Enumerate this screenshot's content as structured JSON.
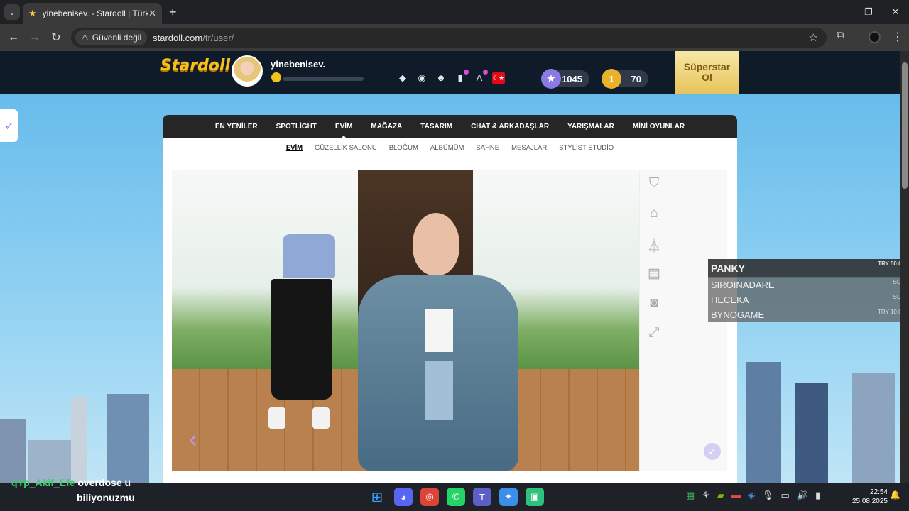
{
  "browser": {
    "tab_title": "yinebenisev. - Stardoll | Türkçe",
    "tab_close": "✕",
    "new_tab": "+",
    "security_label": "Güvenli değil",
    "url_host": "stardoll.com",
    "url_path": "/tr/user/",
    "window_controls": [
      "—",
      "❐",
      "✕"
    ]
  },
  "header": {
    "logo": "Stardoll",
    "username": "yinebenisev.",
    "level": "02",
    "stardollars": "1045",
    "coins": "70",
    "coin_badge": "1",
    "superstar_label_1": "Süperstar",
    "superstar_label_2": "Ol",
    "flag": "☾★"
  },
  "main_nav": [
    "EN YENİLER",
    "SPOTLİGHT",
    "EVİM",
    "MAĞAZA",
    "TASARIM",
    "CHAT & ARKADAŞLAR",
    "YARIŞMALAR",
    "Mİ­Nİ OYUNLAR"
  ],
  "sub_nav": [
    "EVİM",
    "GÜZELLİK SALONU",
    "BLOĞUM",
    "ALBÜMÜM",
    "SAHNE",
    "MESAJLAR",
    "STYLİST STUDİO"
  ],
  "room": {
    "prev_arrow": "‹",
    "ok_icon": "✓"
  },
  "tools": [
    "bag-icon",
    "home-icon",
    "hanger-icon",
    "cart-icon",
    "camera-icon",
    "fullscreen-icon"
  ],
  "chat_overlay": {
    "header_name": "PANKY",
    "header_amount": "TRY 50.00",
    "rows": [
      {
        "name": "SIROINADARE",
        "tag": "SUB"
      },
      {
        "name": "HECEKA",
        "tag": "SUB"
      },
      {
        "name": "BYNOGAME",
        "tag": "TRY 10.00"
      }
    ]
  },
  "stream_chat": {
    "nick": "qYp_Akif_Efe",
    "message": "overdose u",
    "message2": "biliyonuzmu"
  },
  "taskbar": {
    "time": "22:54",
    "date": "25.08.2025"
  }
}
